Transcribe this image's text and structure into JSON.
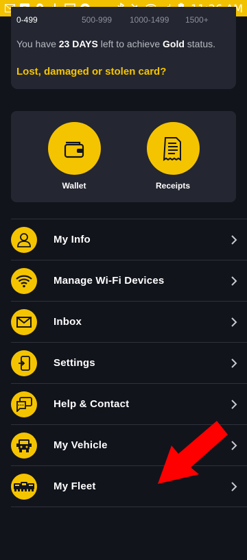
{
  "status_bar": {
    "time": "11:26 AM"
  },
  "tiers": [
    {
      "range": "0-499",
      "active": true
    },
    {
      "range": "500-999",
      "active": false
    },
    {
      "range": "1000-1499",
      "active": false
    },
    {
      "range": "1500+",
      "active": false
    }
  ],
  "status_message": {
    "prefix": "You have ",
    "days": "23 DAYS",
    "middle": " left to achieve ",
    "tier": "Gold",
    "suffix": " status."
  },
  "lost_card_link": "Lost, damaged or stolen card?",
  "quick_actions": [
    {
      "label": "Wallet",
      "icon": "wallet-icon"
    },
    {
      "label": "Receipts",
      "icon": "receipt-icon"
    }
  ],
  "menu": [
    {
      "label": "My Info",
      "icon": "person-icon"
    },
    {
      "label": "Manage Wi-Fi Devices",
      "icon": "wifi-icon"
    },
    {
      "label": "Inbox",
      "icon": "envelope-icon"
    },
    {
      "label": "Settings",
      "icon": "settings-icon"
    },
    {
      "label": "Help & Contact",
      "icon": "chat-icon"
    },
    {
      "label": "My Vehicle",
      "icon": "truck-icon"
    },
    {
      "label": "My Fleet",
      "icon": "fleet-icon"
    }
  ],
  "colors": {
    "accent": "#f5c400",
    "background": "#12141c",
    "card": "#242631",
    "arrow": "#ff0000"
  }
}
